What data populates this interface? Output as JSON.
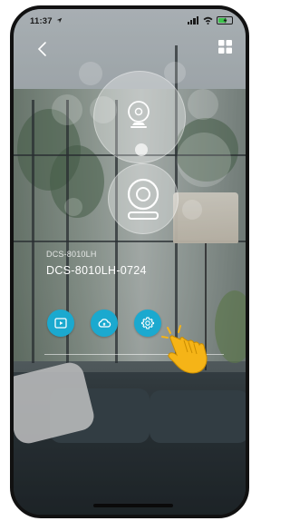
{
  "status_bar": {
    "time": "11:37",
    "location_icon": "location-arrow-icon",
    "signal_icon": "cellular-signal-icon",
    "wifi_icon": "wifi-icon",
    "battery_icon": "battery-charging-icon",
    "battery_color": "#3cc44b"
  },
  "nav": {
    "back_icon": "chevron-left-icon",
    "grid_icon": "grid-icon"
  },
  "device": {
    "model": "DCS-8010LH",
    "name": "DCS-8010LH-0724"
  },
  "actions": [
    {
      "icon": "playback-icon"
    },
    {
      "icon": "cloud-icon"
    },
    {
      "icon": "settings-gear-icon"
    }
  ],
  "colors": {
    "accent": "#1ba9cf",
    "hand": "#f5b417"
  }
}
